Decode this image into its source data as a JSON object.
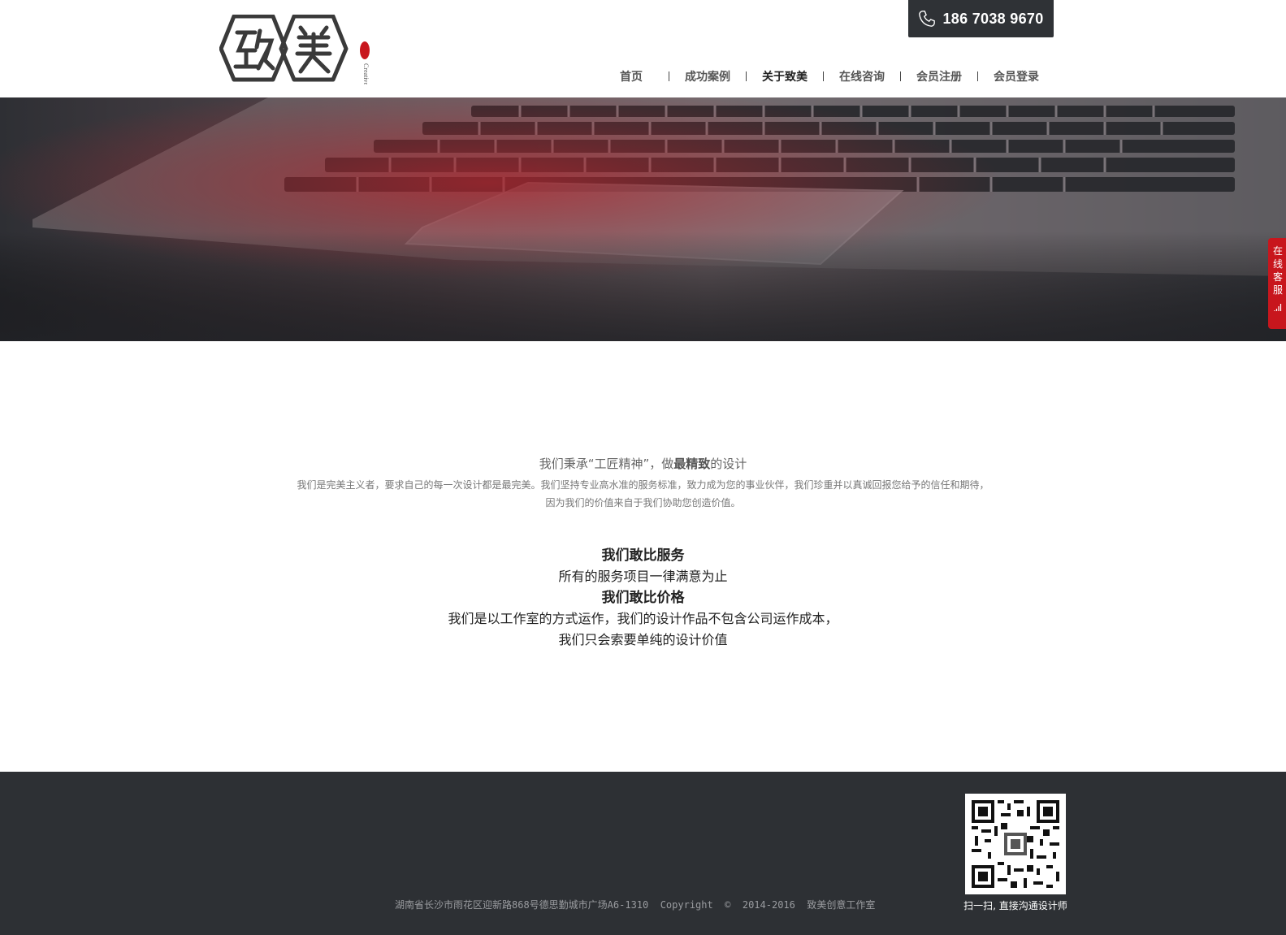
{
  "header": {
    "logo_text": "致美",
    "logo_sub": "Creative 创意",
    "phone": "186 7038 9670",
    "nav": [
      {
        "label": "首页",
        "active": false
      },
      {
        "label": "成功案例",
        "active": false
      },
      {
        "label": "关于致美",
        "active": true
      },
      {
        "label": "在线咨询",
        "active": false
      },
      {
        "label": "会员注册",
        "active": false
      },
      {
        "label": "会员登录",
        "active": false
      }
    ]
  },
  "side_tab": {
    "label": "在线客服",
    "icon": "signal-icon",
    "color": "#c8161d"
  },
  "intro": {
    "title_pre": "我们秉承“工匠精神”，做",
    "title_em": "最精致",
    "title_post": "的设计",
    "line1": "我们是完美主义者，要求自己的每一次设计都是最完美。我们坚持专业高水准的服务标准，致力成为您的事业伙伴，我们珍重并以真诚回报您给予的信任和期待，",
    "line2": "因为我们的价值来自于我们协助您创造价值。"
  },
  "promise": {
    "h1": "我们敢比服务",
    "p1": "所有的服务项目一律满意为止",
    "h2": "我们敢比价格",
    "p2": "我们是以工作室的方式运作，我们的设计作品不包含公司运作成本，",
    "p3": "我们只会索要单纯的设计价值"
  },
  "footer": {
    "address": "湖南省长沙市雨花区迎新路868号德思勤城市广场A6-1310  Copyright  ©  2014-2016  致美创意工作室",
    "qr_caption": "扫一扫, 直接沟通设计师",
    "bg": "#2d3034"
  }
}
